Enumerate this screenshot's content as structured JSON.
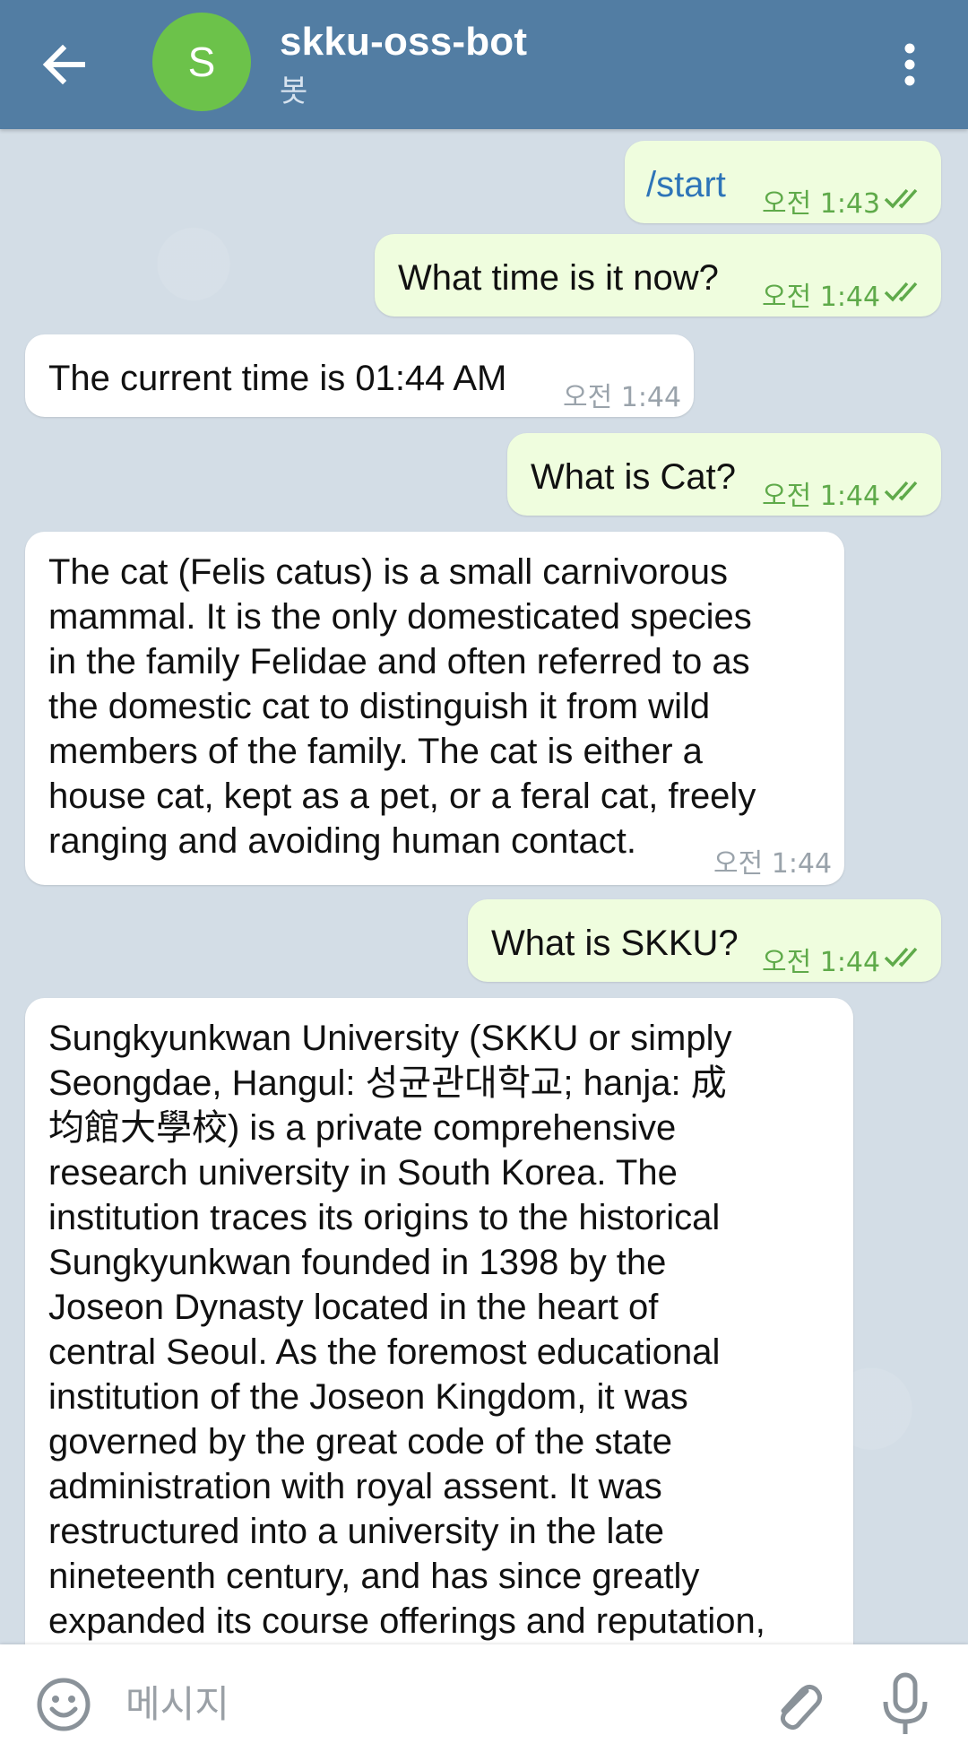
{
  "header": {
    "avatar_letter": "S",
    "title": "skku-oss-bot",
    "subtitle": "봇",
    "back_icon": "arrow-left-icon",
    "menu_icon": "more-vertical-icon"
  },
  "messages": [
    {
      "direction": "out",
      "text": "/start",
      "time": "오전 1:43",
      "status": "read"
    },
    {
      "direction": "out",
      "text": "What time is it now?",
      "time": "오전 1:44",
      "status": "read"
    },
    {
      "direction": "in",
      "text": "The current time is 01:44 AM",
      "time": "오전 1:44"
    },
    {
      "direction": "out",
      "text": "What is Cat?",
      "time": "오전 1:44",
      "status": "read"
    },
    {
      "direction": "in",
      "text": "The cat (Felis catus) is a small carnivorous\nmammal. It is the only domesticated species\nin the family Felidae and often referred to as\nthe domestic cat to distinguish it from wild\nmembers of the family. The cat is either a\nhouse cat, kept as a pet, or a feral cat, freely\nranging and avoiding human contact.",
      "time": "오전 1:44"
    },
    {
      "direction": "out",
      "text": "What is SKKU?",
      "time": "오전 1:44",
      "status": "read"
    },
    {
      "direction": "in",
      "text": "Sungkyunkwan University (SKKU or simply\nSeongdae, Hangul: 성균관대학교; hanja: 成\n均館大學校) is a private comprehensive\nresearch university in South Korea. The\ninstitution traces its origins to the historical\nSungkyunkwan founded in 1398 by the\nJoseon Dynasty located in the heart of\ncentral Seoul. As the foremost educational\ninstitution of the Joseon Kingdom, it was\ngoverned by the great code of the state\nadministration with royal assent. It was\nrestructured into a university in the late\nnineteenth century, and has since greatly\nexpanded its course offerings and reputation,",
      "time": ""
    }
  ],
  "input_bar": {
    "placeholder": "메시지",
    "emoji_icon": "emoji-icon",
    "attach_icon": "paperclip-icon",
    "mic_icon": "microphone-icon"
  },
  "colors": {
    "header": "#527da3",
    "avatar": "#6cc24a",
    "outgoing_bubble": "#effdde",
    "incoming_bubble": "#ffffff",
    "outgoing_time": "#5faa4a",
    "command_link": "#2d74b8"
  }
}
